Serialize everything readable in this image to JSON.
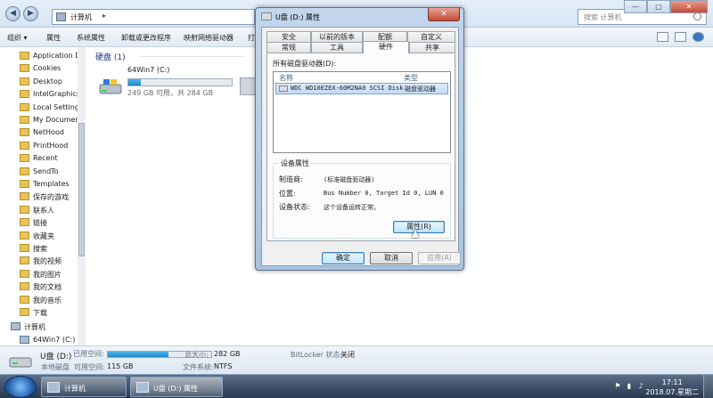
{
  "explorer": {
    "address": {
      "root": "计算机"
    },
    "search": {
      "placeholder": "搜索 计算机"
    },
    "window_controls": {
      "minimize": "—",
      "maximize": "□",
      "close": "✕"
    },
    "toolbar": {
      "organize": "组织 ▾",
      "properties": "属性",
      "system_properties": "系统属性",
      "uninstall": "卸载或更改程序",
      "map_drive": "映射网络驱动器",
      "open": "打"
    },
    "nav": {
      "items": [
        "Application D",
        "Cookies",
        "Desktop",
        "IntelGraphicsl",
        "Local Settings",
        "My Document",
        "NetHood",
        "PrintHood",
        "Recent",
        "SendTo",
        "Templates",
        "保存的游戏",
        "联系人",
        "链接",
        "收藏夹",
        "搜索",
        "我的视频",
        "我的图片",
        "我的文档",
        "我的音乐",
        "下载"
      ],
      "computer": "计算机",
      "drive": "64Win7 (C:)",
      "more": "..."
    },
    "main": {
      "group_header": "硬盘 (1)",
      "drive": {
        "name": "64Win7 (C:)",
        "free_text": "249 GB 可用，共 284 GB",
        "used_fraction": 0.123
      }
    },
    "details": {
      "drive_name": "U盘 (D:)",
      "used_label": "已用空间:",
      "drive_type": "本地磁盘",
      "free_label": "可用空间:",
      "free_value": "115 GB",
      "total_label": "总大小:",
      "total_value": "282 GB",
      "fs_label": "文件系统:",
      "fs_value": "NTFS",
      "bitlocker_label": "BitLocker 状态:",
      "bitlocker_value": "关闭",
      "used_fraction": 0.59
    }
  },
  "dialog": {
    "title": "U盘 (D:) 属性",
    "close": "✕",
    "tabs_row1": [
      "安全",
      "以前的版本",
      "配额",
      "自定义"
    ],
    "tabs_row2": [
      "常规",
      "工具",
      "硬件",
      "共享"
    ],
    "selected_tab": "硬件",
    "all_drives_label": "所有磁盘驱动器(D):",
    "list": {
      "col_name": "名称",
      "col_type": "类型",
      "row_name": "WDC WD10EZEX-60M2NA0 SCSI Disk",
      "row_type": "磁盘驱动器"
    },
    "device_props": {
      "title": "设备属性",
      "manufacturer_label": "制造商:",
      "manufacturer_value": "(标准磁盘驱动器)",
      "location_label": "位置:",
      "location_value": "Bus Number 0, Target Id 0, LUN 0",
      "status_label": "设备状态:",
      "status_value": "这个设备运转正常。",
      "properties_button": "属性(R)"
    },
    "buttons": {
      "ok": "确定",
      "cancel": "取消",
      "apply": "应用(A)"
    }
  },
  "taskbar": {
    "tasks": [
      {
        "label": "计算机"
      },
      {
        "label": "U盘 (D:) 属性"
      }
    ],
    "clock": {
      "time": "17:11",
      "date": "2018.07.星期二"
    },
    "tray": {
      "flag": "⚑",
      "network": "▮",
      "volume": "♪",
      "ime": "英"
    }
  }
}
